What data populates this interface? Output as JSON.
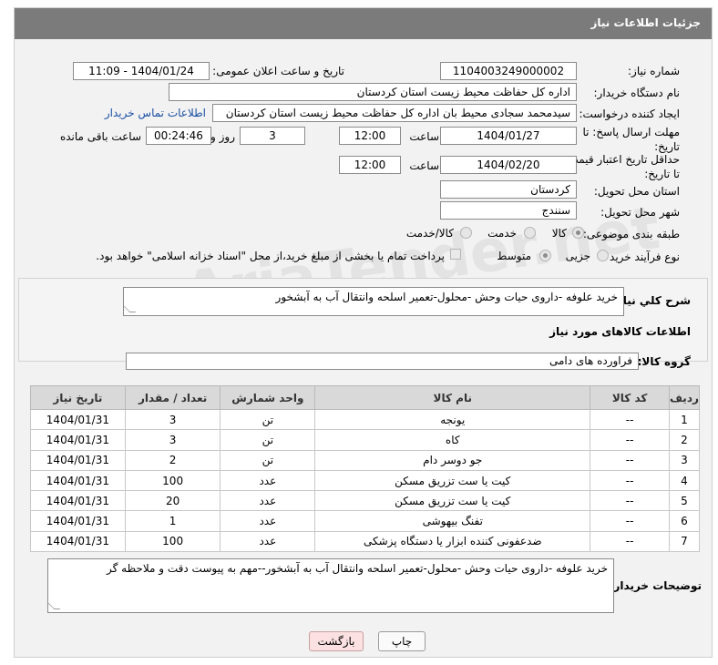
{
  "header": {
    "title": "جزئیات اطلاعات نیاز"
  },
  "form": {
    "need_number": {
      "label": "شماره نیاز:",
      "value": "1104003249000002"
    },
    "announce_datetime": {
      "label": "تاریخ و ساعت اعلان عمومی:",
      "value": "1404/01/24 - 11:09"
    },
    "buyer_org": {
      "label": "نام دستگاه خریدار:",
      "value": "اداره کل حفاظت محیط زیست استان کردستان"
    },
    "requester": {
      "label": "ایجاد کننده درخواست:",
      "value": "سیدمحمد سجادی محیط بان اداره کل حفاظت محیط زیست استان کردستان",
      "contact_link": "اطلاعات تماس خریدار"
    },
    "reply_deadline": {
      "label": "مهلت ارسال پاسخ: تا تاریخ:",
      "date": "1404/01/27",
      "time_label": "ساعت",
      "time": "12:00",
      "days": "3",
      "days_label": "روز و",
      "remaining": "00:24:46",
      "remaining_label": "ساعت باقی مانده"
    },
    "price_validity": {
      "label": "حداقل تاریخ اعتبار قیمت: تا تاریخ:",
      "date": "1404/02/20",
      "time_label": "ساعت",
      "time": "12:00"
    },
    "delivery_province": {
      "label": "استان محل تحویل:",
      "value": "کردستان"
    },
    "delivery_city": {
      "label": "شهر محل تحویل:",
      "value": "سنندج"
    },
    "category": {
      "label": "طبقه بندی موضوعی:",
      "options": [
        "کالا",
        "خدمت",
        "کالا/خدمت"
      ],
      "selected": "کالا"
    },
    "purchase_type": {
      "label": "نوع فرآیند خرید :",
      "options": [
        "جزیی",
        "متوسط"
      ],
      "selected": "متوسط",
      "payment_note": "پرداخت تمام یا بخشی از مبلغ خرید،از محل \"اسناد خزانه اسلامی\" خواهد بود."
    }
  },
  "description": {
    "label": "شرح کلي نياز:",
    "value": "خرید علوفه -داروی حیات وحش -محلول-تعمیر اسلحه وانتقال آب به آبشخور"
  },
  "goods": {
    "section_title": "اطلاعات کالاهای مورد نیاز",
    "group_label": "گروه کالا:",
    "group_value": "فراورده های دامی",
    "columns": [
      "ردیف",
      "کد کالا",
      "نام کالا",
      "واحد شمارش",
      "تعداد / مقدار",
      "تاریخ نیاز"
    ],
    "rows": [
      [
        "1",
        "--",
        "یونجه",
        "تن",
        "3",
        "1404/01/31"
      ],
      [
        "2",
        "--",
        "کاه",
        "تن",
        "3",
        "1404/01/31"
      ],
      [
        "3",
        "--",
        "جو دوسر دام",
        "تن",
        "2",
        "1404/01/31"
      ],
      [
        "4",
        "--",
        "کیت یا ست تزریق مسکن",
        "عدد",
        "100",
        "1404/01/31"
      ],
      [
        "5",
        "--",
        "کیت یا ست تزریق مسکن",
        "عدد",
        "20",
        "1404/01/31"
      ],
      [
        "6",
        "--",
        "تفنگ بیهوشی",
        "عدد",
        "1",
        "1404/01/31"
      ],
      [
        "7",
        "--",
        "ضدعفونی کننده ابزار یا دستگاه پزشکی",
        "عدد",
        "100",
        "1404/01/31"
      ]
    ]
  },
  "buyer_notes": {
    "label": "توضیحات خریدار:",
    "value": "خرید علوفه -داروی حیات وحش -محلول-تعمیر اسلحه وانتقال آب به آبشخور--مهم به پیوست دقت و ملاحظه گر"
  },
  "buttons": {
    "print": "چاپ",
    "back": "بازگشت"
  },
  "watermark": "AriaTender.net"
}
